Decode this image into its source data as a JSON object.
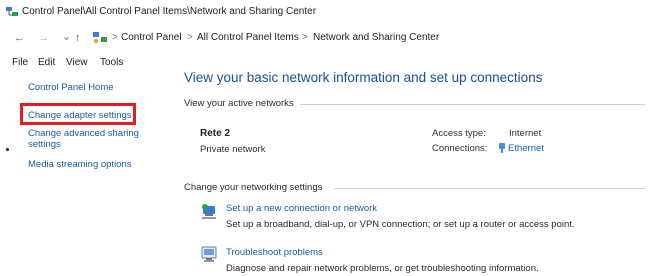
{
  "window": {
    "title": "Control Panel\\All Control Panel Items\\Network and Sharing Center"
  },
  "nav": {
    "back": "←",
    "forward": "→",
    "dropdown": "⌄",
    "up": "↑"
  },
  "breadcrumb": {
    "items": [
      "Control Panel",
      "All Control Panel Items",
      "Network and Sharing Center"
    ],
    "separator": ">"
  },
  "menu": {
    "items": [
      "File",
      "Edit",
      "View",
      "Tools"
    ]
  },
  "left": {
    "links": [
      "Control Panel Home",
      "Change adapter settings",
      "Change advanced sharing settings",
      "Media streaming options"
    ]
  },
  "main": {
    "title": "View your basic network information and set up connections",
    "active_header": "View your active networks",
    "network": {
      "name": "Rete 2",
      "type": "Private network",
      "access_type_label": "Access type:",
      "access_type_value": "Internet",
      "connections_label": "Connections:",
      "connections_value": "Ethernet"
    },
    "change_header": "Change your networking settings",
    "tasks": [
      {
        "link": "Set up a new connection or network",
        "desc": "Set up a broadband, dial-up, or VPN connection; or set up a router or access point.",
        "icon": "network-setup-icon"
      },
      {
        "link": "Troubleshoot problems",
        "desc": "Diagnose and repair network problems, or get troubleshooting information.",
        "icon": "troubleshoot-icon"
      }
    ]
  },
  "colors": {
    "link": "#1a5ca8",
    "title": "#1b4e9e",
    "highlight": "#e02020"
  }
}
